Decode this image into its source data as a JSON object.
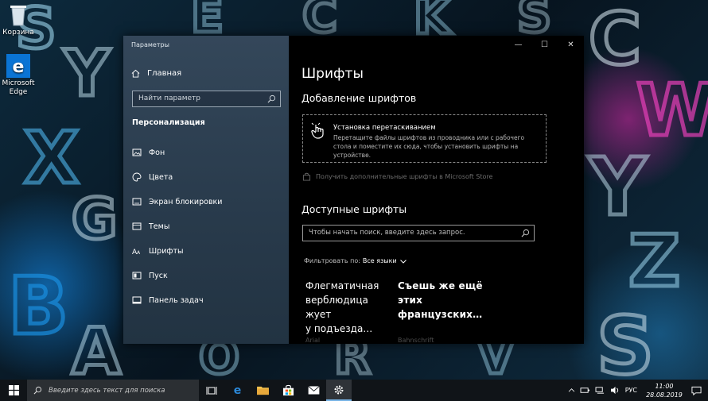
{
  "desktop": {
    "icons": [
      {
        "label": "Корзина",
        "icon": "recycle-bin-icon"
      },
      {
        "label": "Microsoft Edge",
        "icon": "edge-icon"
      }
    ]
  },
  "window": {
    "title": "Параметры",
    "controls": {
      "minimize": "—",
      "maximize": "☐",
      "close": "✕"
    }
  },
  "sidebar": {
    "home_label": "Главная",
    "search_placeholder": "Найти параметр",
    "section_title": "Персонализация",
    "items": [
      {
        "label": "Фон",
        "icon": "picture-icon"
      },
      {
        "label": "Цвета",
        "icon": "palette-icon"
      },
      {
        "label": "Экран блокировки",
        "icon": "lock-screen-icon"
      },
      {
        "label": "Темы",
        "icon": "themes-icon"
      },
      {
        "label": "Шрифты",
        "icon": "fonts-icon"
      },
      {
        "label": "Пуск",
        "icon": "start-icon"
      },
      {
        "label": "Панель задач",
        "icon": "taskbar-icon"
      }
    ]
  },
  "main": {
    "title": "Шрифты",
    "add_heading": "Добавление шрифтов",
    "drop_zone": {
      "title": "Установка перетаскиванием",
      "description": "Перетащите файлы шрифтов из проводника или с рабочего стола и поместите их сюда, чтобы установить шрифты на устройстве."
    },
    "store_link": "Получить дополнительные шрифты в Microsoft Store",
    "available_heading": "Доступные шрифты",
    "font_search_placeholder": "Чтобы начать поиск, введите здесь запрос.",
    "filter_label": "Фильтровать по:",
    "filter_value": "Все языки",
    "fonts": [
      {
        "lines": [
          "Флегматичная",
          "верблюдица",
          "жует",
          "у подъезда…"
        ],
        "name": "Arial"
      },
      {
        "lines": [
          "Съешь же ещё",
          "этих",
          "французских…"
        ],
        "name": "Bahnschrift"
      }
    ]
  },
  "taskbar": {
    "search_placeholder": "Введите здесь текст для поиска",
    "language": "РУС",
    "time": "11:00",
    "date": "28.08.2019"
  },
  "colors": {
    "accent": "#0078d7",
    "window_bg": "#000000",
    "sidebar_bg": "#2c3e50"
  }
}
